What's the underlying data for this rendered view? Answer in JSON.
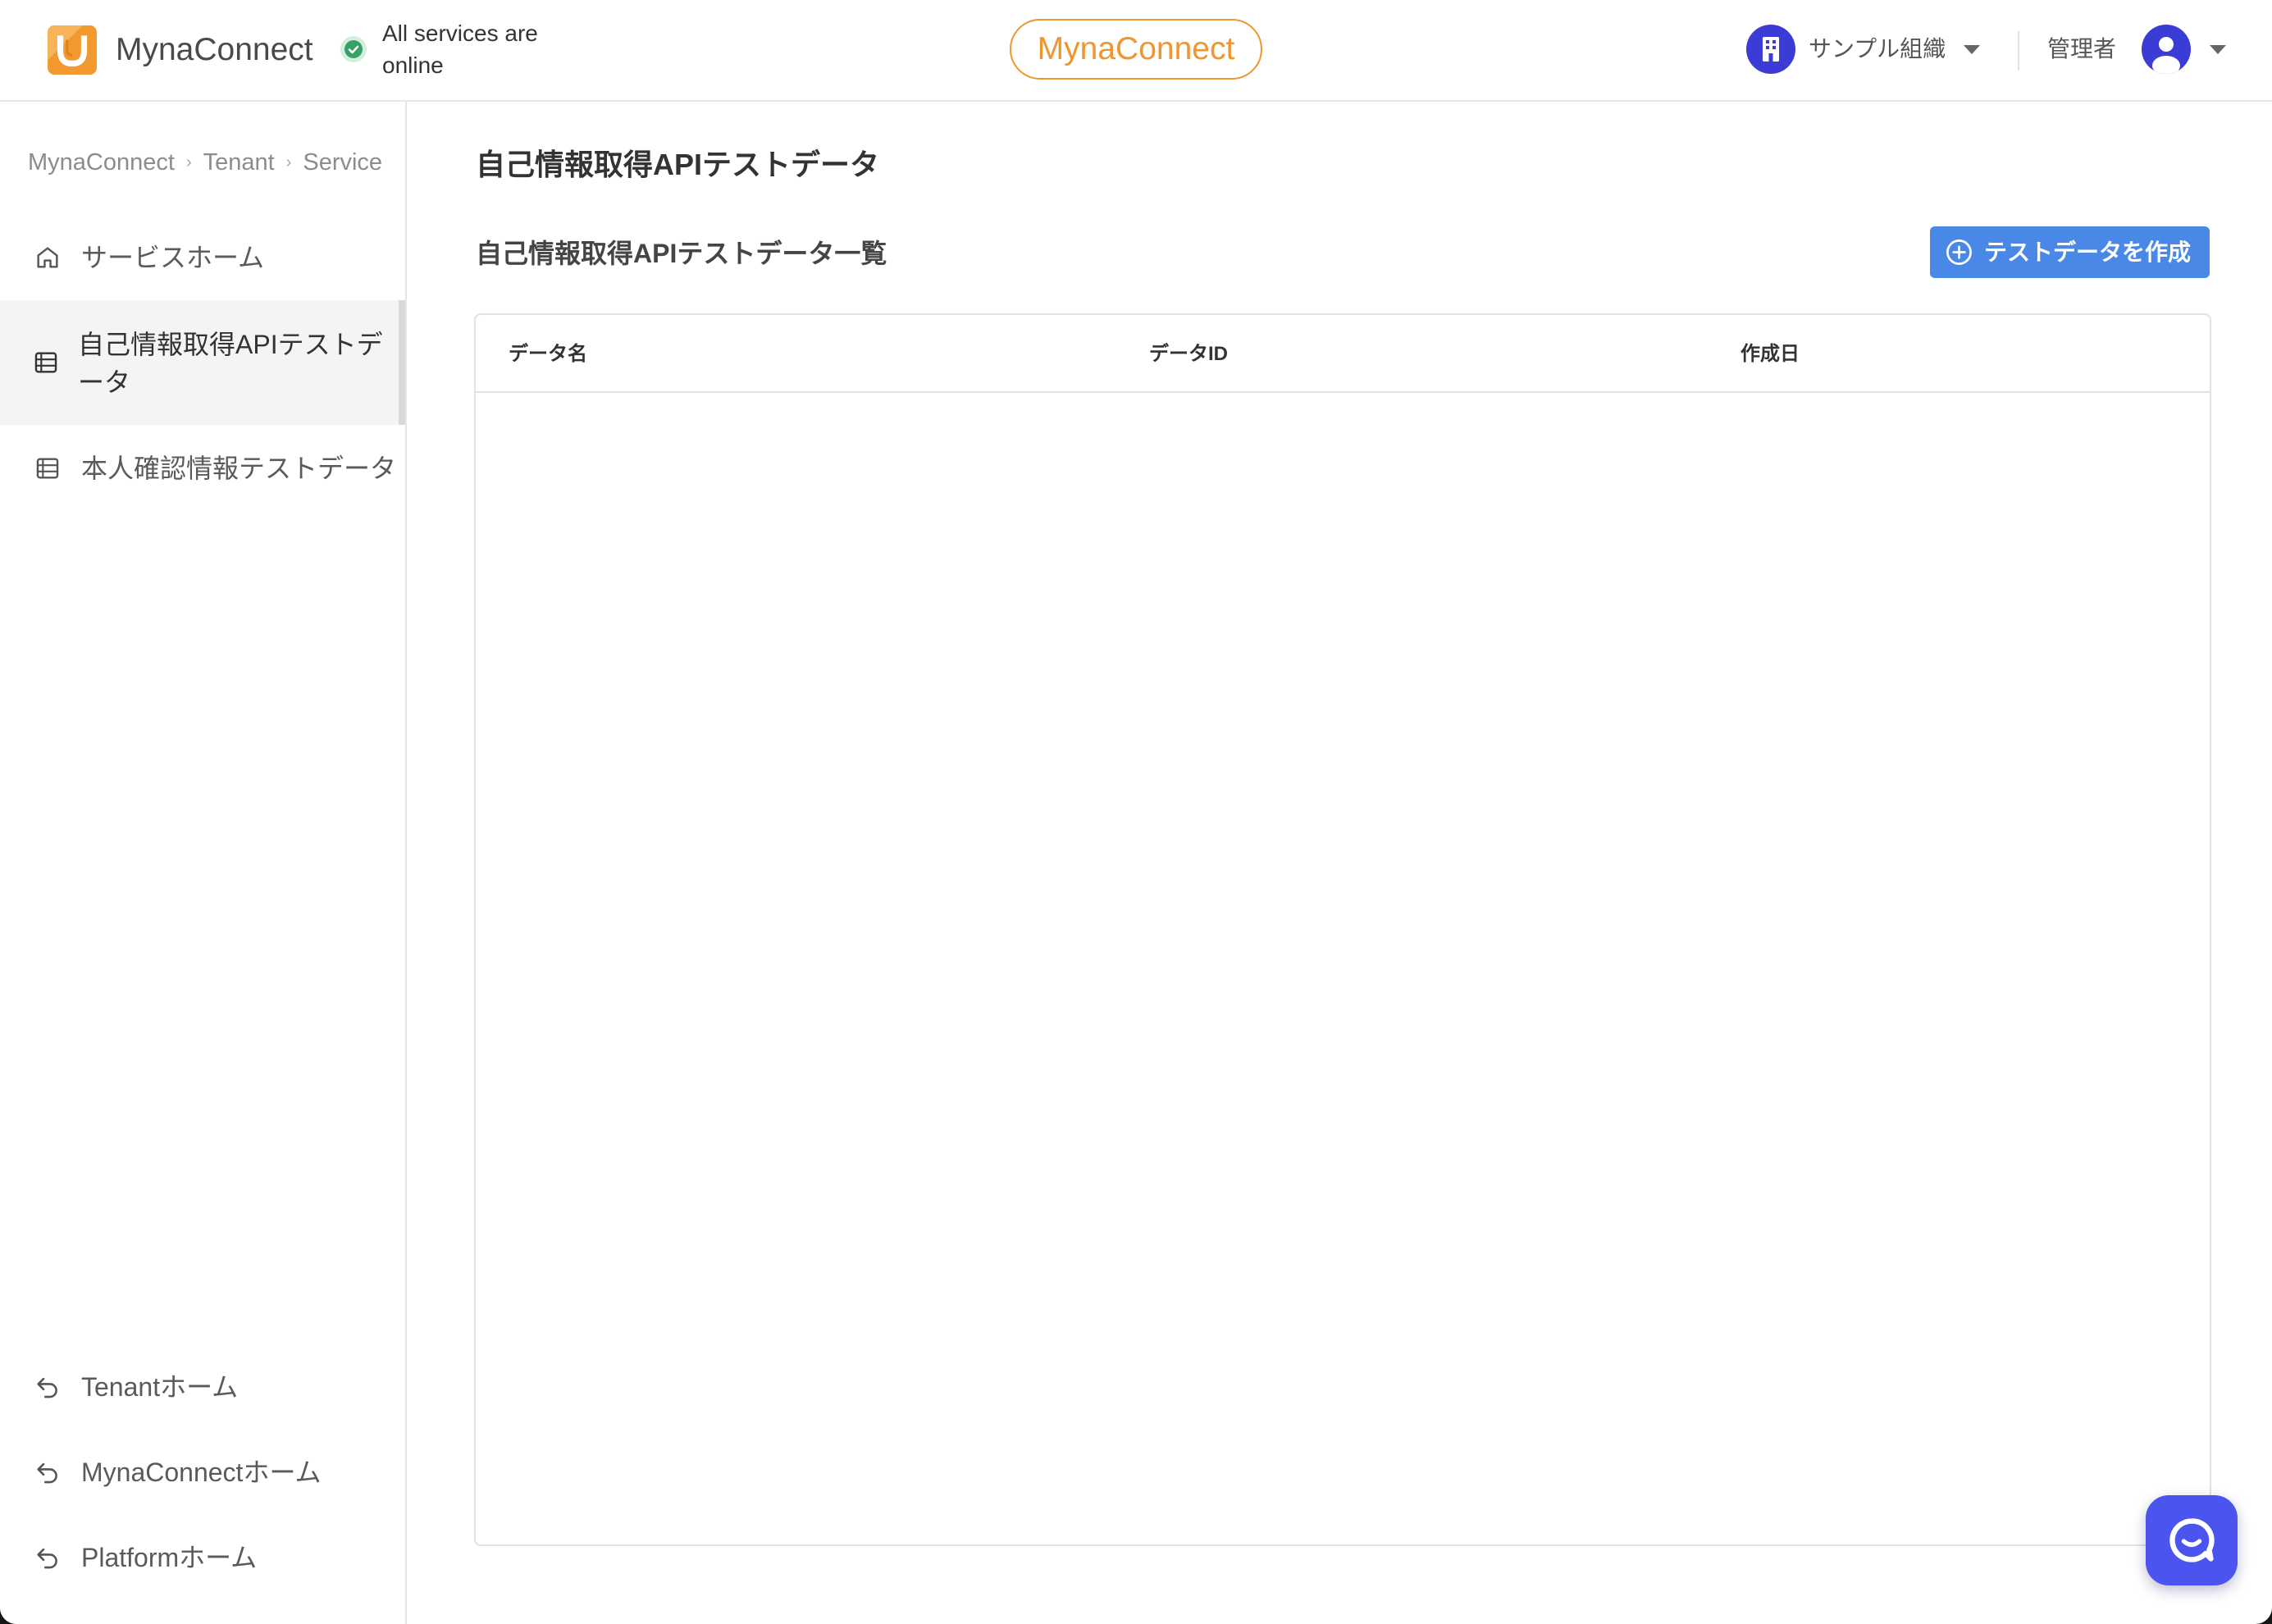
{
  "header": {
    "app_name": "MynaConnect",
    "logo_icon": "myna-connect-logo",
    "status_text": "All services are online",
    "status_icon": "check-circle-icon",
    "center_badge": "MynaConnect",
    "org_name": "サンプル組織",
    "org_icon": "building-icon",
    "user_role": "管理者",
    "user_icon": "user-avatar-icon"
  },
  "sidebar": {
    "breadcrumb": [
      "MynaConnect",
      "Tenant",
      "Service"
    ],
    "breadcrumb_separator": "›",
    "nav_items": [
      {
        "label": "サービスホーム",
        "icon": "home-icon",
        "active": false
      },
      {
        "label": "自己情報取得APIテストデータ",
        "icon": "table-list-icon",
        "active": true
      },
      {
        "label": "本人確認情報テストデータ",
        "icon": "table-list-icon",
        "active": false
      }
    ],
    "bottom_links": [
      {
        "label": "Tenantホーム",
        "icon": "return-arrow-icon"
      },
      {
        "label": "MynaConnectホーム",
        "icon": "return-arrow-icon"
      },
      {
        "label": "Platformホーム",
        "icon": "return-arrow-icon"
      }
    ]
  },
  "main": {
    "page_title": "自己情報取得APIテストデータ",
    "section_title": "自己情報取得APIテストデータ一覧",
    "create_button": {
      "label": "テストデータを作成",
      "icon": "plus-circle-icon"
    },
    "table": {
      "columns": [
        "データ名",
        "データID",
        "作成日"
      ],
      "rows": []
    }
  },
  "chat_widget": {
    "icon": "chat-bubble-icon"
  },
  "colors": {
    "accent": "#f0962e",
    "primary": "#4a88e8",
    "chat": "#4b54ef",
    "status": "#37a168",
    "brand": "#3b3bd6",
    "active_bg": "#f4f4f5"
  }
}
